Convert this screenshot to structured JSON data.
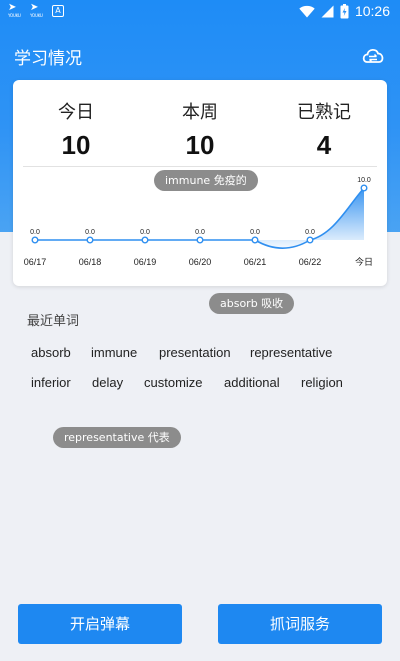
{
  "status_bar": {
    "app_glyph": "➤",
    "app_label": "YOUKU",
    "a_badge": "A",
    "time": "10:26"
  },
  "header": {
    "title": "学习情况",
    "icon": "cloud-sync-icon"
  },
  "stats": [
    {
      "label": "今日",
      "value": "10"
    },
    {
      "label": "本周",
      "value": "10"
    },
    {
      "label": "已熟记",
      "value": "4"
    }
  ],
  "chart_data": {
    "type": "area",
    "categories": [
      "06/17",
      "06/18",
      "06/19",
      "06/20",
      "06/21",
      "06/22",
      "今日"
    ],
    "values": [
      0.0,
      0.0,
      0.0,
      0.0,
      0.0,
      0.0,
      10.0
    ],
    "data_labels": [
      "0.0",
      "0.0",
      "0.0",
      "0.0",
      "0.0",
      "0.0",
      "10.0"
    ],
    "ylim": [
      0,
      10
    ],
    "color": "#2f8ff0"
  },
  "toasts": [
    {
      "text": "immune 免疫的"
    },
    {
      "text": "absorb 吸收"
    },
    {
      "text": "representative 代表"
    }
  ],
  "recent": {
    "title": "最近单词",
    "words": [
      "absorb",
      "immune",
      "presentation",
      "representative",
      "inferior",
      "delay",
      "customize",
      "additional",
      "religion"
    ]
  },
  "buttons": {
    "left": "开启弹幕",
    "right": "抓词服务"
  },
  "colors": {
    "header": "#2f93f5",
    "accent": "#1e88f1",
    "toast": "#8c8c8c"
  }
}
